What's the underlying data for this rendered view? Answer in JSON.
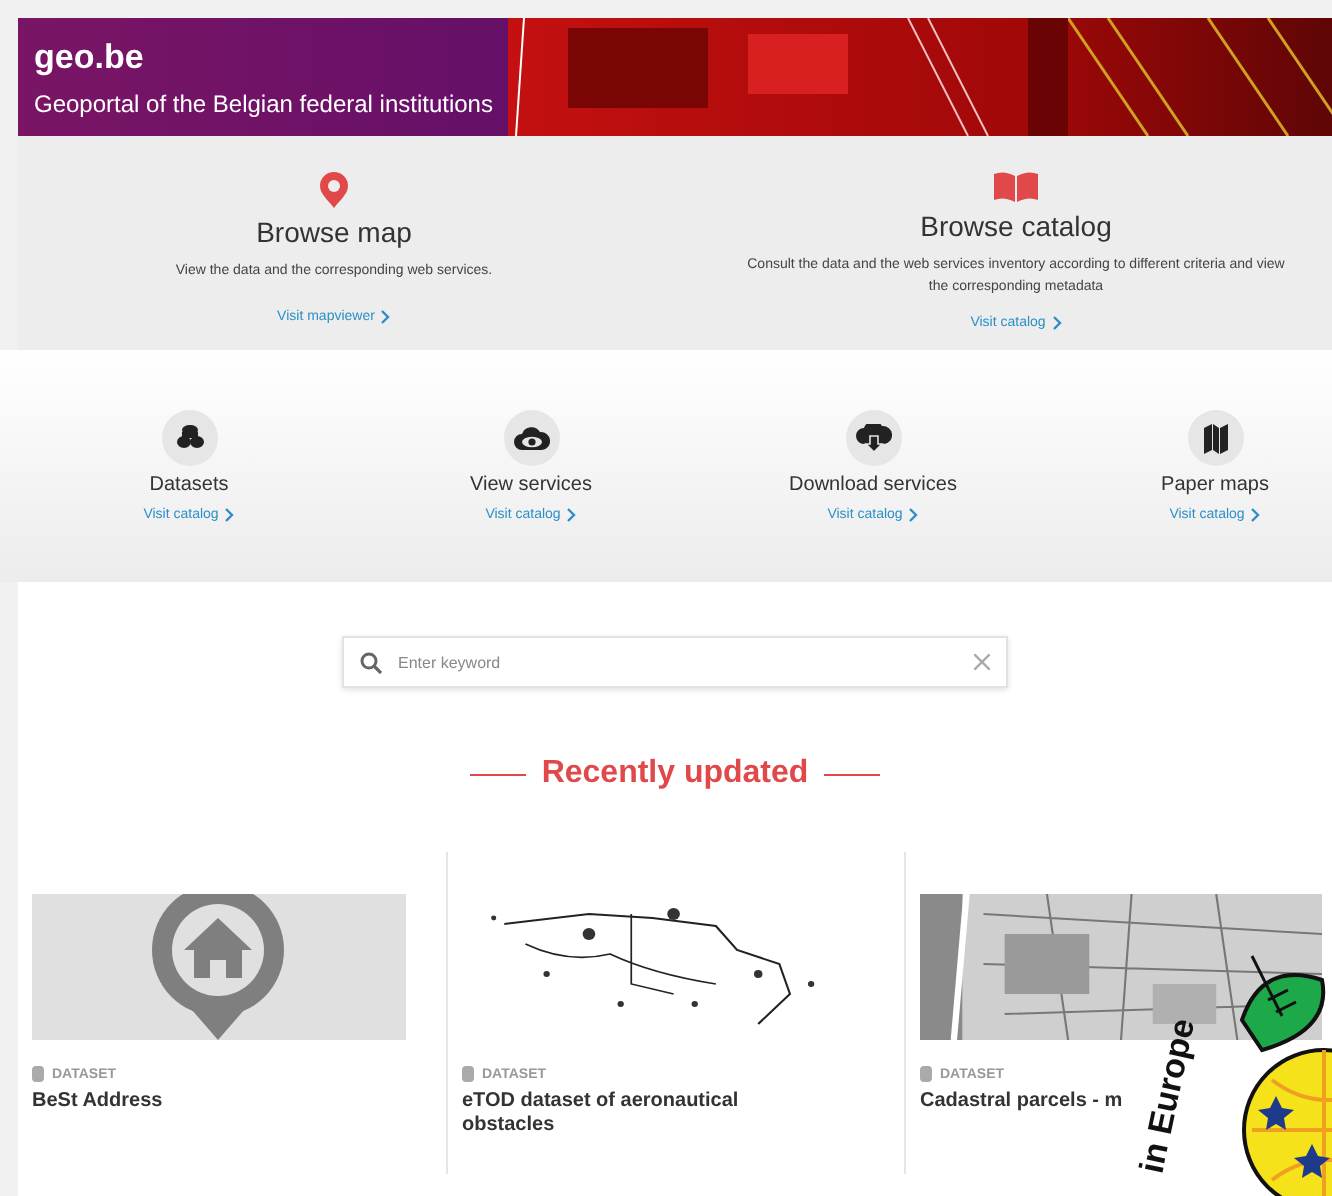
{
  "header": {
    "title": "geo.be",
    "subtitle": "Geoportal of the Belgian federal institutions"
  },
  "browse": [
    {
      "kind": "map",
      "title": "Browse map",
      "description": "View the data and the corresponding web services.",
      "link": "Visit mapviewer"
    },
    {
      "kind": "catalog",
      "title": "Browse catalog",
      "description": "Consult the data and the web services inventory according to different criteria and view the corresponding metadata",
      "link": "Visit catalog"
    }
  ],
  "services": [
    {
      "kind": "datasets",
      "title": "Datasets",
      "link": "Visit catalog"
    },
    {
      "kind": "view",
      "title": "View services",
      "link": "Visit catalog"
    },
    {
      "kind": "download",
      "title": "Download services",
      "link": "Visit catalog"
    },
    {
      "kind": "paper",
      "title": "Paper maps",
      "link": "Visit catalog"
    }
  ],
  "search": {
    "placeholder": "Enter keyword"
  },
  "recent": {
    "heading": "Recently updated",
    "cards": [
      {
        "kind": "placeholder",
        "type": "DATASET",
        "title": "BeSt Address"
      },
      {
        "kind": "scatter",
        "type": "DATASET",
        "title": "eTOD dataset of aeronautical obstacles"
      },
      {
        "kind": "streets",
        "type": "DATASET",
        "title": "Cadastral parcels - m"
      }
    ]
  },
  "badge": {
    "text": "in Europe"
  }
}
